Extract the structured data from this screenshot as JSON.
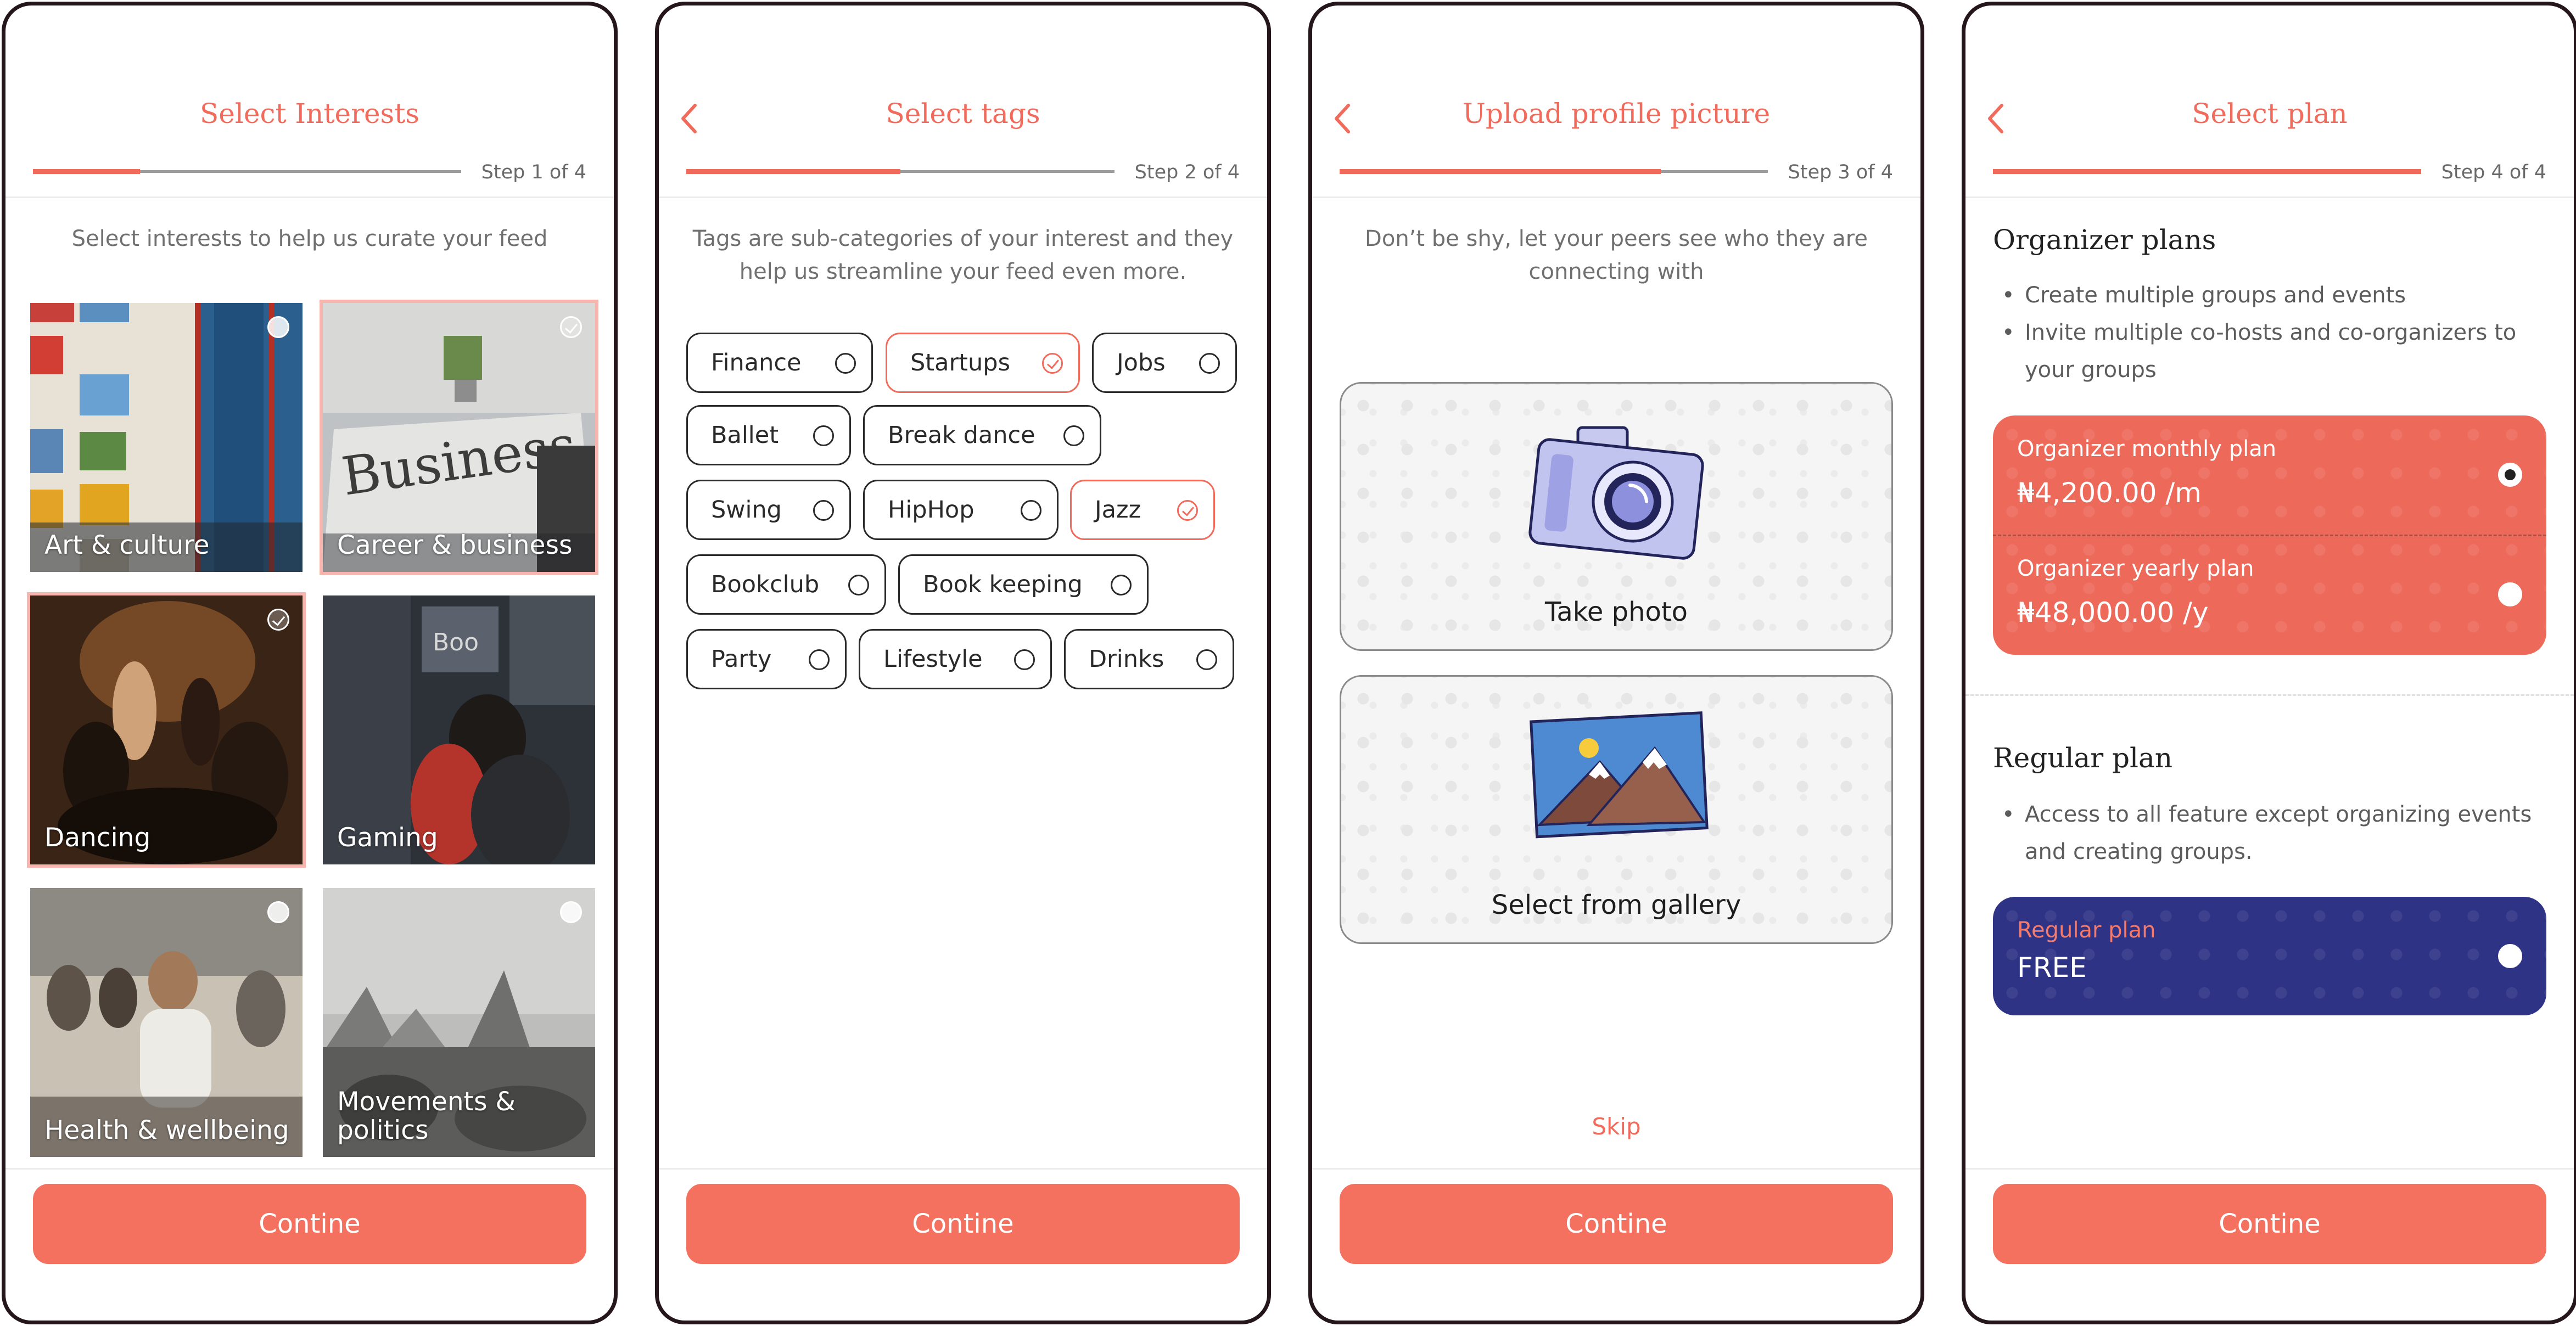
{
  "colors": {
    "accent": "#f4705f",
    "accent_text": "#f06b5c",
    "frame": "#24161a",
    "regular_plan_bg": "#2f3385"
  },
  "button_label": "Contine",
  "screens": [
    {
      "title": "Select Interests",
      "step": "Step 1 of 4",
      "progress": 0.25,
      "subtitle": "Select interests to help us curate your feed",
      "interests": [
        {
          "label": "Art & culture",
          "selected": false
        },
        {
          "label": "Career & business",
          "selected": true
        },
        {
          "label": "Dancing",
          "selected": true
        },
        {
          "label": "Gaming",
          "selected": false
        },
        {
          "label": "Health & wellbeing",
          "selected": false
        },
        {
          "label": "Movements & politics",
          "selected": false
        }
      ],
      "image_text": {
        "business": "Business",
        "gaming": "Boo"
      }
    },
    {
      "title": "Select tags",
      "step": "Step 2 of 4",
      "progress": 0.5,
      "subtitle": "Tags are sub-categories of your interest and they help us streamline your feed even more.",
      "tags": [
        {
          "label": "Finance",
          "selected": false
        },
        {
          "label": "Startups",
          "selected": true
        },
        {
          "label": "Jobs",
          "selected": false
        },
        {
          "label": "Ballet",
          "selected": false
        },
        {
          "label": "Break dance",
          "selected": false
        },
        {
          "label": "Swing",
          "selected": false
        },
        {
          "label": "HipHop",
          "selected": false
        },
        {
          "label": "Jazz",
          "selected": true
        },
        {
          "label": "Bookclub",
          "selected": false
        },
        {
          "label": "Book keeping",
          "selected": false
        },
        {
          "label": "Party",
          "selected": false
        },
        {
          "label": "Lifestyle",
          "selected": false
        },
        {
          "label": "Drinks",
          "selected": false
        }
      ]
    },
    {
      "title": "Upload profile picture",
      "step": "Step 3 of 4",
      "progress": 0.75,
      "subtitle": "Don’t be shy, let your peers see who they are connecting with",
      "take_photo": "Take photo",
      "gallery": "Select from gallery",
      "skip": "Skip"
    },
    {
      "title": "Select plan",
      "step": "Step 4 of 4",
      "progress": 1.0,
      "organizer": {
        "heading": "Organizer plans",
        "bullets": [
          "Create multiple groups and events",
          "Invite multiple co-hosts and co-organizers to your groups"
        ],
        "plans": [
          {
            "name": "Organizer monthly plan",
            "price": "₦4,200.00 /m",
            "selected": true
          },
          {
            "name": "Organizer yearly plan",
            "price": "₦48,000.00 /y",
            "selected": false
          }
        ]
      },
      "regular": {
        "heading": "Regular plan",
        "bullets": [
          "Access to all feature except organizing events and creating groups."
        ],
        "plan": {
          "name": "Regular plan",
          "price": "FREE",
          "selected": false
        }
      }
    }
  ]
}
